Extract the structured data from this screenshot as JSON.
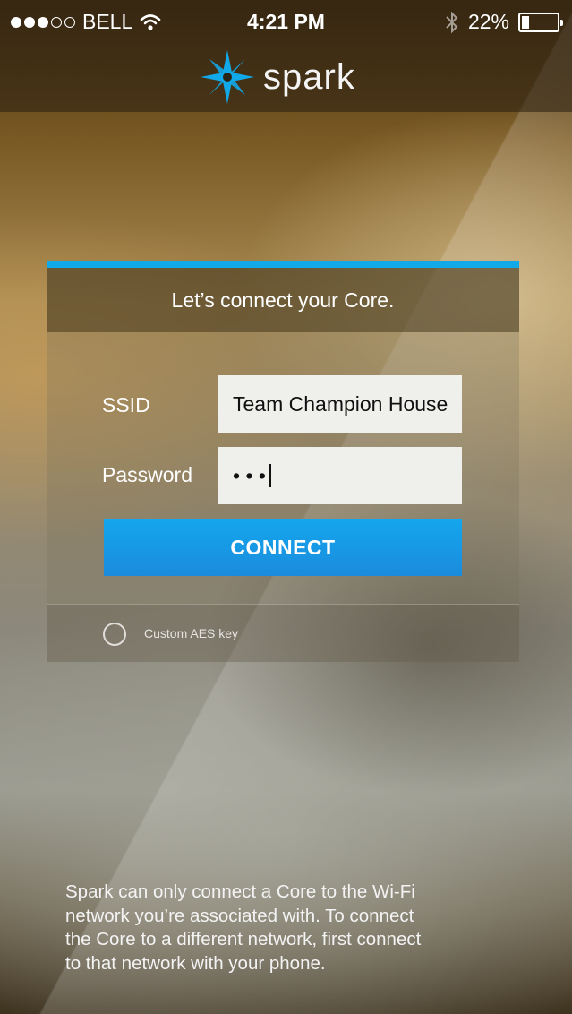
{
  "status_bar": {
    "carrier": "BELL",
    "time": "4:21 PM",
    "battery": "22%",
    "battery_level": 0.22,
    "icons": [
      "signal-icon",
      "wifi-icon",
      "bluetooth-icon",
      "battery-icon"
    ]
  },
  "header": {
    "logo_text": "spark"
  },
  "card": {
    "title": "Let’s connect your Core.",
    "ssid_label": "SSID",
    "ssid_value": "Team Champion House",
    "password_label": "Password",
    "password_value": "• • •",
    "connect_label": "CONNECT",
    "aes_label": "Custom AES key"
  },
  "footnote": {
    "line1": "Spark can only connect a Core to the Wi-Fi",
    "line2": "network you’re associated with.  To connect",
    "line3": "the Core to a different network, first connect",
    "line4": "to that network with your phone."
  },
  "colors": {
    "accent": "#12a9e8",
    "button": "#1b8cdc",
    "logo": "#12a9e8"
  }
}
